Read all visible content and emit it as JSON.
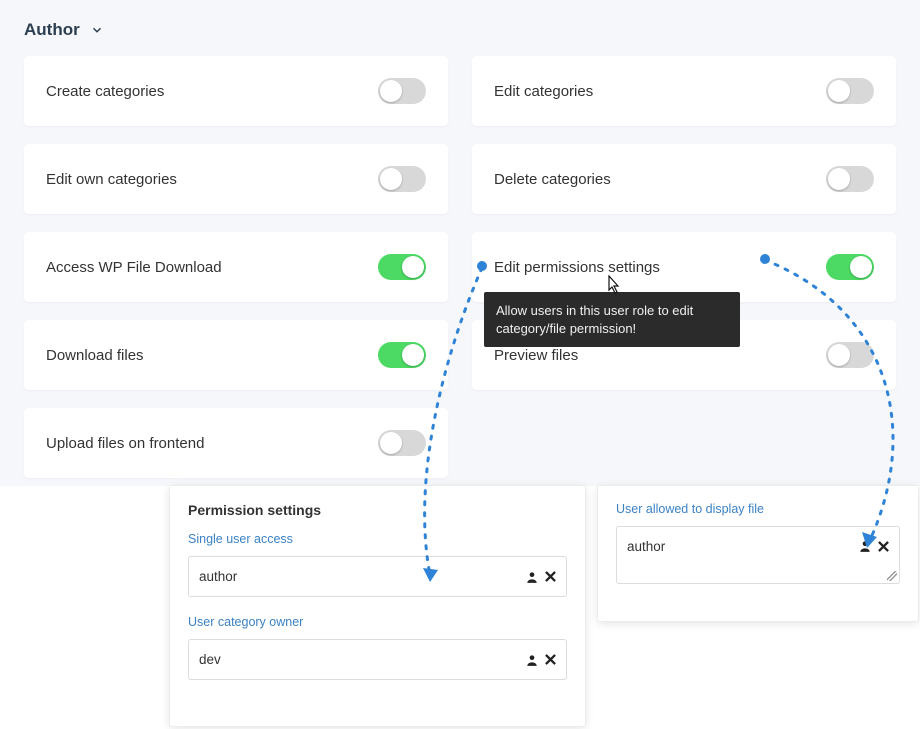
{
  "role_dropdown": {
    "label": "Author"
  },
  "permissions": {
    "create_categories": {
      "label": "Create categories",
      "on": false
    },
    "edit_categories": {
      "label": "Edit categories",
      "on": false
    },
    "edit_own_categories": {
      "label": "Edit own categories",
      "on": false
    },
    "delete_categories": {
      "label": "Delete categories",
      "on": false
    },
    "access_wpfd": {
      "label": "Access WP File Download",
      "on": true
    },
    "edit_perm_settings": {
      "label": "Edit permissions settings",
      "on": true
    },
    "download_files": {
      "label": "Download files",
      "on": true
    },
    "preview_files": {
      "label": "Preview files",
      "on": false
    },
    "upload_frontend": {
      "label": "Upload files on frontend",
      "on": false
    }
  },
  "tooltip": {
    "text": "Allow users in this user role to edit category/file permission!"
  },
  "panel_left": {
    "title": "Permission settings",
    "single_user_label": "Single user access",
    "single_user_value": "author",
    "owner_label": "User category owner",
    "owner_value": "dev"
  },
  "panel_right": {
    "title": "User allowed to display file",
    "value": "author"
  }
}
